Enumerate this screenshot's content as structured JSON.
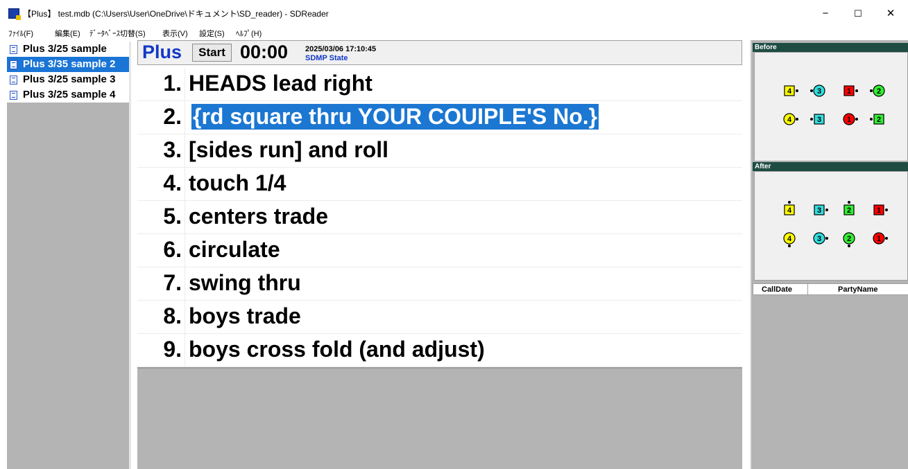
{
  "window": {
    "title": "【Plus】 test.mdb (C:\\Users\\User\\OneDrive\\ドキュメント\\SD_reader) - SDReader",
    "minimize": "−",
    "maximize": "☐",
    "close": "✕"
  },
  "menu": [
    "ﾌｧｲﾙ(F)",
    "編集(E)",
    "ﾃﾞｰﾀﾍﾞｰｽ切替(S)",
    "表示(V)",
    "設定(S)",
    "ﾍﾙﾌﾟ(H)"
  ],
  "sidebar": {
    "items": [
      {
        "label": "Plus 3/25 sample",
        "selected": false
      },
      {
        "label": "Plus 3/35 sample 2",
        "selected": true
      },
      {
        "label": "Plus 3/25 sample 3",
        "selected": false
      },
      {
        "label": "Plus 3/25 sample 4",
        "selected": false
      }
    ]
  },
  "header": {
    "level": "Plus",
    "start_label": "Start",
    "timer": "00:00",
    "datetime": "2025/03/06 17:10:45",
    "state": "SDMP State"
  },
  "calls": [
    {
      "num": "1.",
      "text": "HEADS lead right",
      "selected": false
    },
    {
      "num": "2.",
      "text": "{rd square thru YOUR COUIPLE'S No.}",
      "selected": true
    },
    {
      "num": "3.",
      "text": "[sides run] and roll",
      "selected": false
    },
    {
      "num": "4.",
      "text": "touch 1/4",
      "selected": false
    },
    {
      "num": "5.",
      "text": "centers trade",
      "selected": false
    },
    {
      "num": "6.",
      "text": "circulate",
      "selected": false
    },
    {
      "num": "7.",
      "text": "swing thru",
      "selected": false
    },
    {
      "num": "8.",
      "text": "boys trade",
      "selected": false
    },
    {
      "num": "9.",
      "text": "boys cross fold (and adjust)",
      "selected": false
    }
  ],
  "right_panel": {
    "before_label": "Before",
    "after_label": "After",
    "table_headers": [
      "CallDate",
      "PartyName"
    ],
    "colors": {
      "yellow": "#ffff00",
      "cyan": "#33dddd",
      "red": "#ff0000",
      "green": "#33ee33"
    },
    "before": [
      [
        {
          "n": "4",
          "shape": "square",
          "color": "yellow",
          "facing": "right"
        },
        {
          "n": "3",
          "shape": "circle",
          "color": "cyan",
          "facing": "left"
        },
        {
          "n": "1",
          "shape": "square",
          "color": "red",
          "facing": "right"
        },
        {
          "n": "2",
          "shape": "circle",
          "color": "green",
          "facing": "left"
        }
      ],
      [
        {
          "n": "4",
          "shape": "circle",
          "color": "yellow",
          "facing": "right"
        },
        {
          "n": "3",
          "shape": "square",
          "color": "cyan",
          "facing": "left"
        },
        {
          "n": "1",
          "shape": "circle",
          "color": "red",
          "facing": "right"
        },
        {
          "n": "2",
          "shape": "square",
          "color": "green",
          "facing": "left"
        }
      ]
    ],
    "after": [
      [
        {
          "n": "4",
          "shape": "square",
          "color": "yellow",
          "facing": "up"
        },
        {
          "n": "3",
          "shape": "square",
          "color": "cyan",
          "facing": "right"
        },
        {
          "n": "2",
          "shape": "square",
          "color": "green",
          "facing": "up"
        },
        {
          "n": "1",
          "shape": "square",
          "color": "red",
          "facing": "right"
        }
      ],
      [
        {
          "n": "4",
          "shape": "circle",
          "color": "yellow",
          "facing": "down"
        },
        {
          "n": "3",
          "shape": "circle",
          "color": "cyan",
          "facing": "right"
        },
        {
          "n": "2",
          "shape": "circle",
          "color": "green",
          "facing": "down"
        },
        {
          "n": "1",
          "shape": "circle",
          "color": "red",
          "facing": "right"
        }
      ]
    ]
  }
}
